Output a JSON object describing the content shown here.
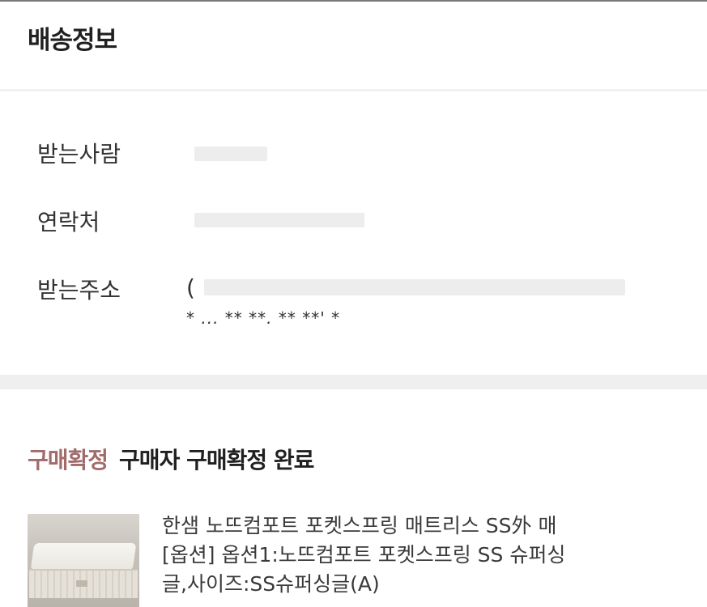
{
  "shipping": {
    "title": "배송정보",
    "rows": [
      {
        "label": "받는사람",
        "value": ""
      },
      {
        "label": "연락처",
        "value": ""
      },
      {
        "label": "받는주소",
        "value": "(",
        "value_line2": "* ... ** **. ** **' *"
      }
    ]
  },
  "order": {
    "status_badge": "구매확정",
    "status_text": "구매자 구매확정 완료",
    "product": {
      "line1": "한샘 노뜨컴포트 포켓스프링 매트리스 SS外 매",
      "line2": "[옵션] 옵션1:노뜨컴포트 포켓스프링 SS 슈퍼싱",
      "line3": "글,사이즈:SS슈퍼싱글(A)",
      "thumb_icon": "mattress-thumbnail"
    }
  },
  "colors": {
    "status_badge": "#a26b6b",
    "section_separator": "#efefef"
  }
}
